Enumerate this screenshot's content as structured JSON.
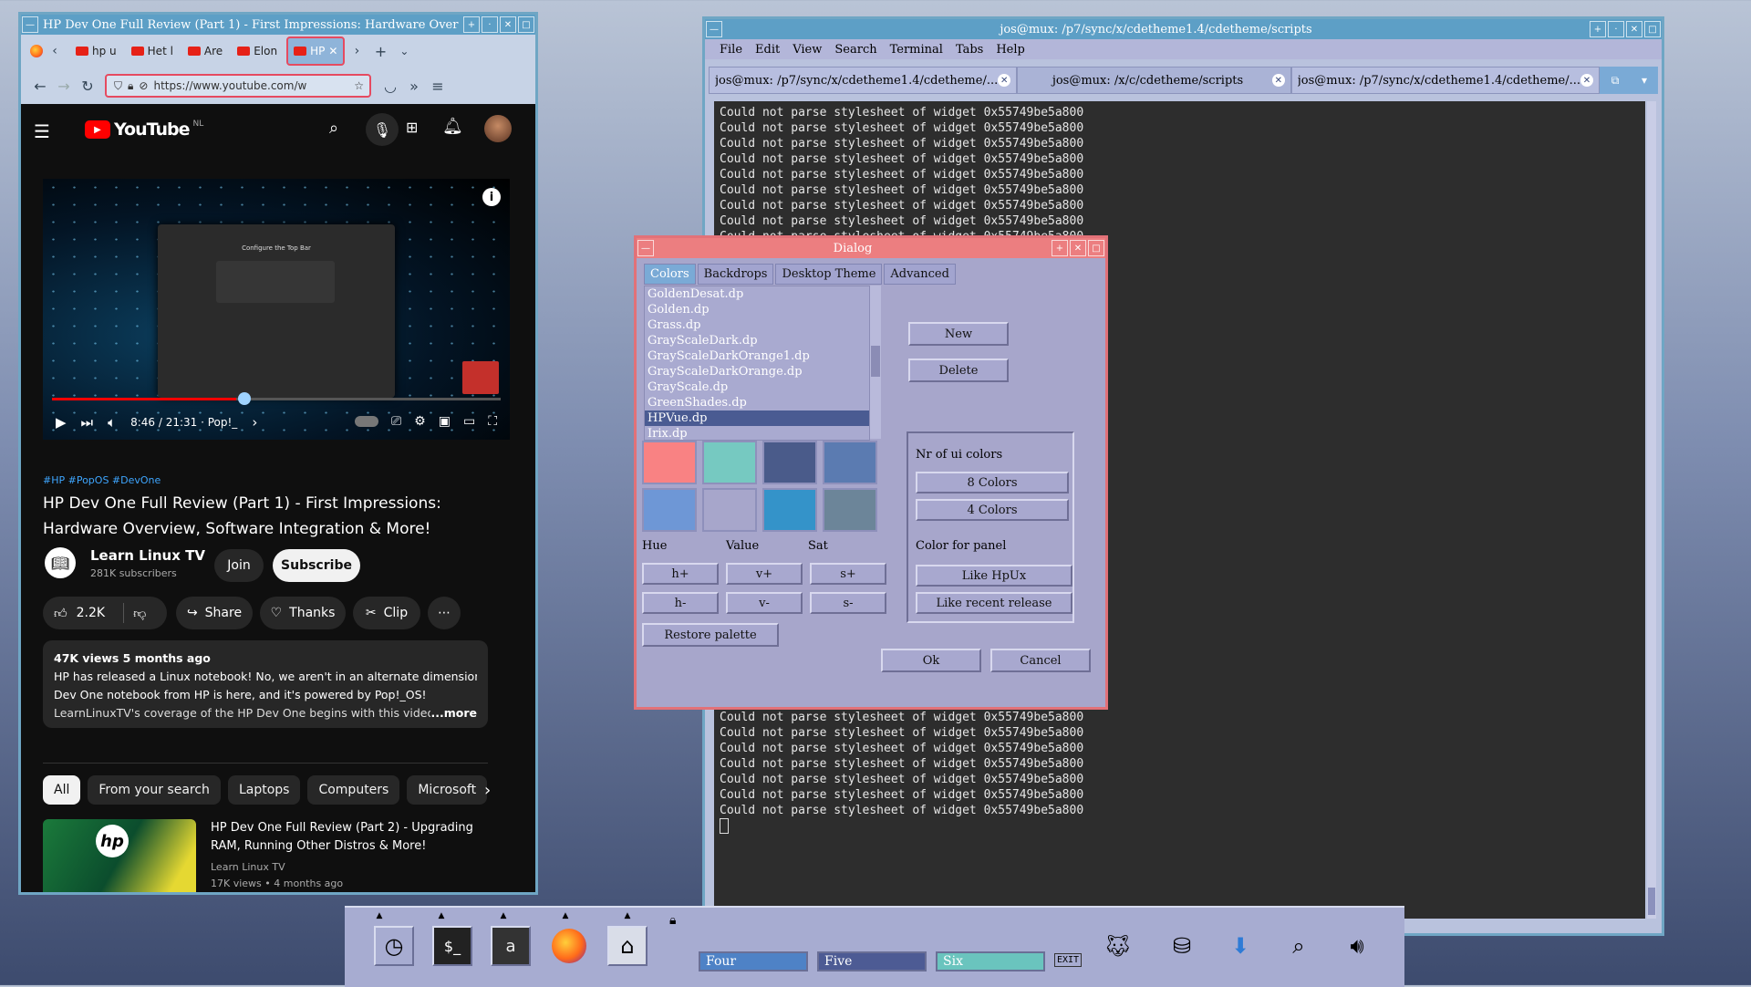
{
  "firefox": {
    "window_title": "HP Dev One Full Review (Part 1) - First Impressions: Hardware Over",
    "tabs": [
      "hp u",
      "Het l",
      "Are",
      "Elon",
      "HP"
    ],
    "url": "https://www.youtube.com/w"
  },
  "youtube": {
    "logo": "YouTube",
    "region": "NL",
    "player_time": "8:46 / 21:31 · Pop!_",
    "video_title_line1": "HP Dev One Full Review (Part 1) - First Impressions:",
    "video_title_line2": "Hardware Overview, Software Integration & More!",
    "hashtags": "#HP #PopOS #DevOne",
    "channel": "Learn Linux TV",
    "subscribers": "281K subscribers",
    "join": "Join",
    "subscribe": "Subscribe",
    "likes": "2.2K",
    "share": "Share",
    "thanks": "Thanks",
    "clip": "Clip",
    "views_date": "47K views  5 months ago",
    "desc_line1": "HP has released a Linux notebook! No, we aren't in an alternate dimension, the",
    "desc_line2": "Dev One notebook from HP is here, and it's powered by Pop!_OS!",
    "desc_line3": "LearnLinuxTV's coverage of the HP Dev One begins with this video, wh",
    "more": "...more",
    "chips": [
      "All",
      "From your search",
      "Laptops",
      "Computers",
      "Microsoft"
    ],
    "rec_title_line1": "HP Dev One Full Review (Part 2) - Upgrading",
    "rec_title_line2": "RAM, Running Other Distros & More!",
    "rec_channel": "Learn Linux TV",
    "rec_meta": "17K views  • 4 months ago",
    "player_overlay_title": "Configure the Top Bar"
  },
  "terminal": {
    "window_title": "jos@mux: /p7/sync/x/cdetheme1.4/cdetheme/scripts",
    "menu": [
      "File",
      "Edit",
      "View",
      "Search",
      "Terminal",
      "Tabs",
      "Help"
    ],
    "tabs": [
      "jos@mux: /p7/sync/x/cdetheme1.4/cdetheme/...",
      "jos@mux: /x/c/cdetheme/scripts",
      "jos@mux: /p7/sync/x/cdetheme1.4/cdetheme/..."
    ],
    "line": "Could not parse stylesheet of widget 0x55749be5a800",
    "top_line_count": 9,
    "bottom_line_count": 13
  },
  "dialog": {
    "title": "Dialog",
    "tabs": [
      "Colors",
      "Backdrops",
      "Desktop Theme",
      "Advanced"
    ],
    "files": [
      "GoldenDesat.dp",
      "Golden.dp",
      "Grass.dp",
      "GrayScaleDark.dp",
      "GrayScaleDarkOrange1.dp",
      "GrayScaleDarkOrange.dp",
      "GrayScale.dp",
      "GreenShades.dp",
      "HPVue.dp",
      "Irix.dp"
    ],
    "selected_file": "HPVue.dp",
    "new": "New",
    "delete": "Delete",
    "nr_ui_colors": "Nr of ui colors",
    "colors8": "8 Colors",
    "colors4": "4 Colors",
    "color_for_panel": "Color for panel",
    "like_hpux": "Like HpUx",
    "like_recent": "Like recent release",
    "hue": "Hue",
    "value": "Value",
    "sat": "Sat",
    "h_plus": "h+",
    "v_plus": "v+",
    "s_plus": "s+",
    "h_minus": "h-",
    "v_minus": "v-",
    "s_minus": "s-",
    "restore": "Restore palette",
    "ok": "Ok",
    "cancel": "Cancel",
    "swatches": [
      "#f98283",
      "#76c9c1",
      "#4a5b8a",
      "#5b7bb1",
      "#6e97d6",
      "#a7a6cb",
      "#3493c9",
      "#6c8599"
    ]
  },
  "panel": {
    "workspaces": [
      "Four",
      "Five",
      "Six"
    ],
    "exit": "EXIT"
  }
}
